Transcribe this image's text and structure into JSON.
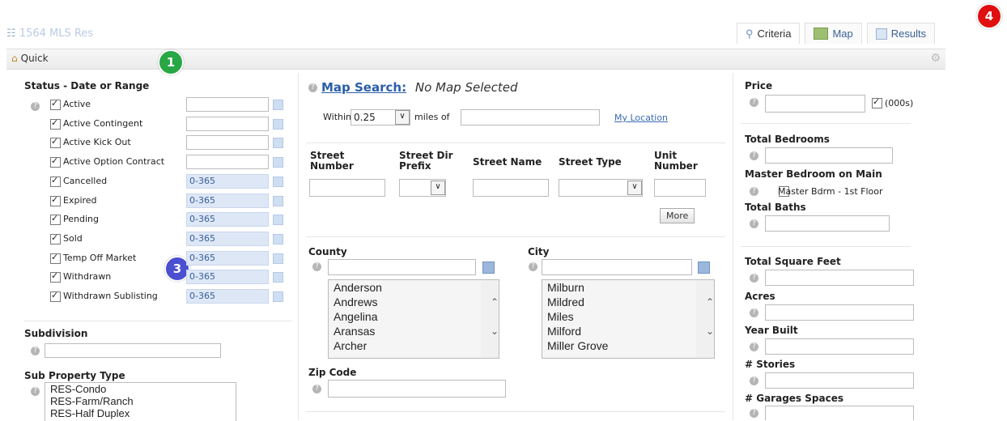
{
  "header": {
    "top_link": "1564 MLS Res",
    "tabs": [
      {
        "label": "Criteria",
        "icon": "search-icon"
      },
      {
        "label": "Map",
        "icon": "map-icon"
      },
      {
        "label": "Results",
        "icon": "results-icon"
      }
    ]
  },
  "quickbar": {
    "label": "Quick",
    "icon": "home-icon",
    "settings_icon": "gear-icon"
  },
  "badges": [
    "1",
    "3",
    "4"
  ],
  "status": {
    "title": "Status - Date or Range",
    "rows": [
      {
        "label": "Active",
        "checked": true,
        "range": ""
      },
      {
        "label": "Active Contingent",
        "checked": true,
        "range": ""
      },
      {
        "label": "Active Kick Out",
        "checked": true,
        "range": ""
      },
      {
        "label": "Active Option Contract",
        "checked": true,
        "range": ""
      },
      {
        "label": "Cancelled",
        "checked": true,
        "range": "0-365"
      },
      {
        "label": "Expired",
        "checked": true,
        "range": "0-365"
      },
      {
        "label": "Pending",
        "checked": true,
        "range": "0-365"
      },
      {
        "label": "Sold",
        "checked": true,
        "range": "0-365"
      },
      {
        "label": "Temp Off Market",
        "checked": true,
        "range": "0-365"
      },
      {
        "label": "Withdrawn",
        "checked": true,
        "range": "0-365"
      },
      {
        "label": "Withdrawn Sublisting",
        "checked": true,
        "range": "0-365"
      }
    ]
  },
  "subdivision": {
    "title": "Subdivision",
    "value": ""
  },
  "sub_property_type": {
    "title": "Sub Property Type",
    "options": [
      "RES-Condo",
      "RES-Farm/Ranch",
      "RES-Half Duplex"
    ]
  },
  "map": {
    "title": "Map Search:",
    "status": "No Map Selected",
    "within_label": "Within",
    "within_value": "0.25",
    "miles_label": "miles of",
    "my_location": "My Location"
  },
  "street": {
    "number_label": "Street Number",
    "dir_label": "Street Dir Prefix",
    "name_label": "Street Name",
    "type_label": "Street Type",
    "unit_label": "Unit Number",
    "more": "More"
  },
  "county": {
    "title": "County",
    "options": [
      "Anderson",
      "Andrews",
      "Angelina",
      "Aransas",
      "Archer"
    ]
  },
  "city": {
    "title": "City",
    "options": [
      "Milburn",
      "Mildred",
      "Miles",
      "Milford",
      "Miller Grove"
    ]
  },
  "zip": {
    "title": "Zip Code"
  },
  "right": {
    "price": "Price",
    "price_unit": "(000s)",
    "total_bedrooms": "Total Bedrooms",
    "master_main": "Master Bedroom on Main",
    "master_option": "Master Bdrm - 1st Floor",
    "total_baths": "Total Baths",
    "total_sqft": "Total Square Feet",
    "acres": "Acres",
    "year_built": "Year Built",
    "stories": "# Stories",
    "garages": "# Garages Spaces"
  }
}
